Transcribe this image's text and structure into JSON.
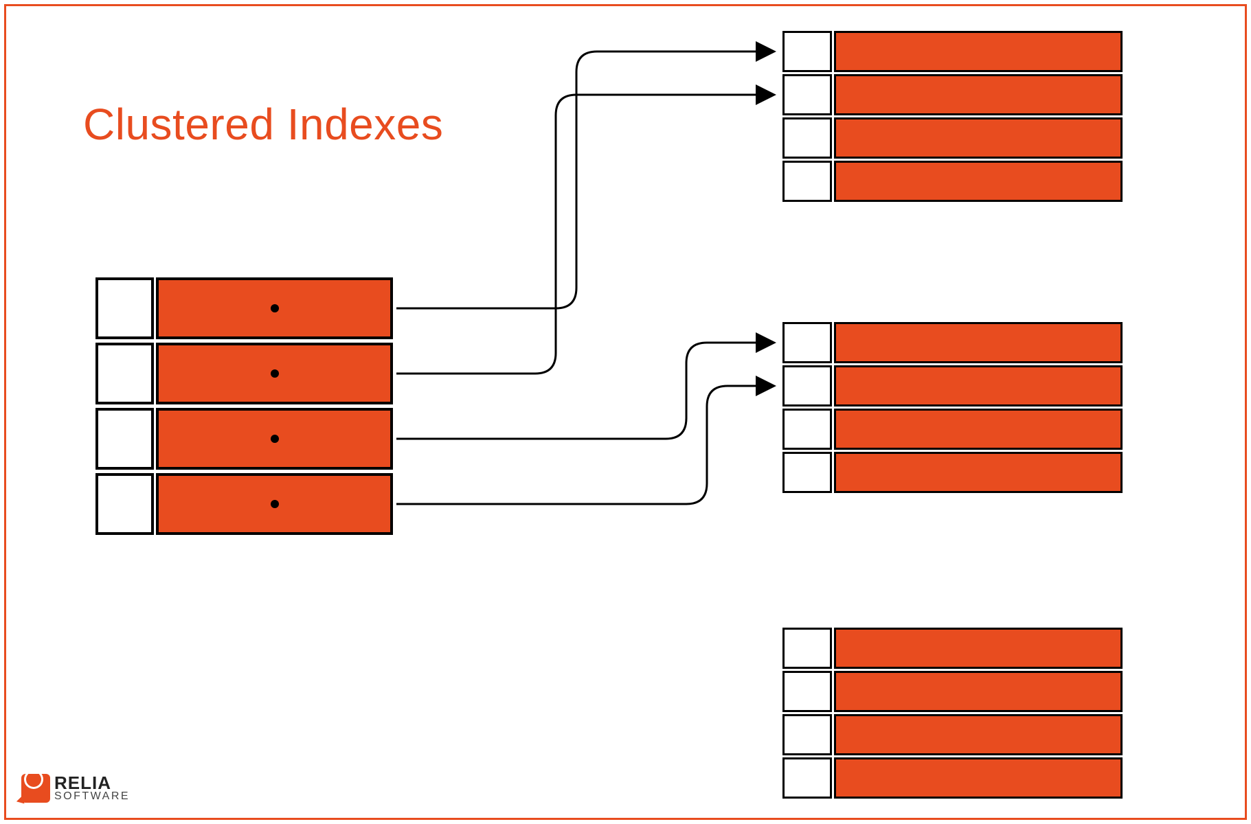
{
  "title": "Clustered Indexes",
  "colors": {
    "accent": "#e84c1f",
    "ink": "#000000",
    "paper": "#ffffff"
  },
  "logo": {
    "name": "RELIA",
    "sub": "SOFTWARE"
  },
  "diagram": {
    "index_node": {
      "rows": 4,
      "has_dots": true
    },
    "leaf_nodes": [
      {
        "rows": 4
      },
      {
        "rows": 4
      },
      {
        "rows": 4
      }
    ],
    "arrows": [
      {
        "from_row": 1,
        "to_leaf": 1,
        "to_row": 1
      },
      {
        "from_row": 2,
        "to_leaf": 1,
        "to_row": 2
      },
      {
        "from_row": 3,
        "to_leaf": 2,
        "to_row": 1
      },
      {
        "from_row": 4,
        "to_leaf": 2,
        "to_row": 2
      }
    ]
  }
}
